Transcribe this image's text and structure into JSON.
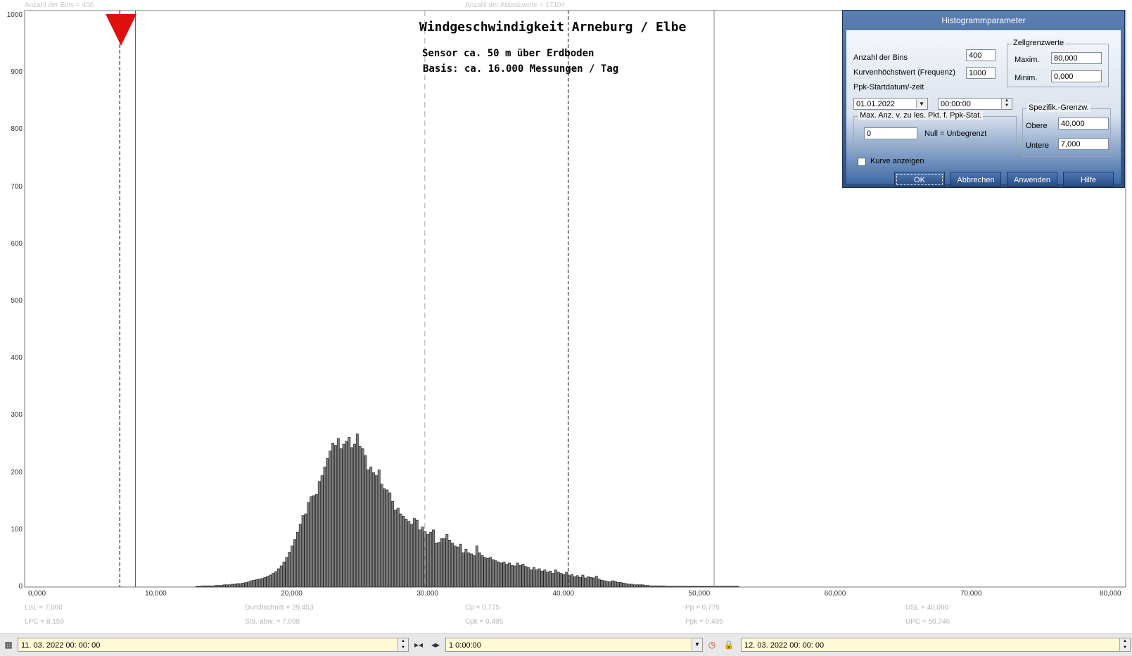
{
  "header": {
    "bins_info": "Anzahl der Bins =   400",
    "samples_info": "Anzahl der Abtastwerte = 17104"
  },
  "chart": {
    "title": "Windgeschwindigkeit  Arneburg / Elbe",
    "subtitle1": "Sensor ca. 50 m über Erdboden",
    "subtitle2": "Basis: ca. 16.000 Messungen / Tag"
  },
  "chart_data": {
    "type": "bar",
    "xlim": [
      0,
      80
    ],
    "ylim": [
      0,
      1000
    ],
    "bin_width": 0.2,
    "bin_start": 7.8,
    "y_ticks": [
      "0",
      "100",
      "200",
      "300",
      "400",
      "500",
      "600",
      "700",
      "800",
      "900",
      "1000"
    ],
    "x_ticks": [
      {
        "value": 0,
        "label": "0,000"
      },
      {
        "value": 10,
        "label": "10,000"
      },
      {
        "value": 20,
        "label": "20,000"
      },
      {
        "value": 30,
        "label": "30,000"
      },
      {
        "value": 40,
        "label": "40,000"
      },
      {
        "value": 50,
        "label": "50,000"
      },
      {
        "value": 60,
        "label": "60,000"
      },
      {
        "value": 70,
        "label": "70,000"
      },
      {
        "value": 80,
        "label": "80,000"
      }
    ],
    "reference_lines": {
      "lsl": 7.0,
      "lpc": 8.159,
      "mean": 29.453,
      "usl": 40.0,
      "upc": 50.746
    },
    "values": [
      0,
      0,
      0,
      0,
      0,
      0,
      0,
      0,
      0,
      0,
      0,
      0,
      0,
      0,
      0,
      0,
      0,
      0,
      0,
      0,
      0,
      0,
      0,
      0,
      1,
      1,
      2,
      2,
      2,
      2,
      2,
      3,
      3,
      3,
      4,
      4,
      4,
      5,
      5,
      6,
      6,
      7,
      8,
      9,
      11,
      12,
      13,
      14,
      15,
      17,
      19,
      21,
      24,
      27,
      32,
      37,
      44,
      52,
      61,
      72,
      83,
      96,
      110,
      125,
      128,
      148,
      158,
      160,
      162,
      185,
      195,
      210,
      225,
      238,
      252,
      248,
      260,
      242,
      250,
      255,
      262,
      244,
      250,
      268,
      246,
      242,
      230,
      205,
      210,
      200,
      195,
      205,
      180,
      172,
      170,
      165,
      150,
      135,
      138,
      128,
      124,
      119,
      115,
      110,
      120,
      117,
      100,
      105,
      97,
      92,
      96,
      100,
      77,
      78,
      85,
      85,
      92,
      82,
      77,
      72,
      70,
      75,
      60,
      66,
      60,
      58,
      55,
      72,
      60,
      55,
      52,
      50,
      52,
      48,
      46,
      44,
      42,
      44,
      40,
      42,
      38,
      37,
      42,
      38,
      40,
      36,
      34,
      30,
      34,
      30,
      32,
      28,
      30,
      26,
      28,
      24,
      30,
      26,
      24,
      22,
      26,
      20,
      22,
      18,
      20,
      17,
      21,
      16,
      18,
      17,
      16,
      19,
      14,
      12,
      11,
      10,
      9,
      11,
      10,
      8,
      8,
      7,
      6,
      5,
      5,
      4,
      4,
      4,
      4,
      3,
      3,
      2,
      2,
      2,
      2,
      2,
      2,
      1,
      1,
      1,
      1,
      1,
      1,
      1,
      1,
      1,
      1,
      1,
      1,
      1,
      1,
      1,
      1,
      1,
      1,
      1,
      1,
      1,
      1,
      1,
      1,
      1,
      1,
      1
    ]
  },
  "stats": {
    "lsl": "LSL = 7,000",
    "lpc": "LPC = 8,159",
    "mean": "Durchschnitt  = 29,453",
    "std": "Std.-abw. = 7,098",
    "cp": "Cp  = 0,775",
    "cpk": "Cpk = 0,495",
    "pp": "Pp  = 0,775",
    "ppk": "Ppk = 0,495",
    "usl": "USL = 40,000",
    "upc": "UPC = 50,746"
  },
  "dialog": {
    "title": "Histogrammparameter",
    "bins_label": "Anzahl der Bins",
    "bins_value": "400",
    "curve_max_label": "Kurvenhöchstwert (Frequenz)",
    "curve_max_value": "1000",
    "ppk_start_label": "Ppk-Startdatum/-zeit",
    "date_value": "01.01.2022",
    "time_value": "00:00:00",
    "cell_group_title": "Zellgrenzwerte",
    "maxim_label": "Maxim.",
    "maxim_value": "80,000",
    "minim_label": "Minim.",
    "minim_value": "0,000",
    "maxpts_group_title": "Max. Anz. v. zu les. Pkt. f. Ppk-Stat.",
    "maxpts_value": "0",
    "null_label": "Null = Unbegrenzt",
    "spec_group_title": "Spezifik.-Grenzw.",
    "upper_label": "Obere",
    "upper_value": "40,000",
    "lower_label": "Untere",
    "lower_value": "7,000",
    "show_curve_label": "Kurve anzeigen",
    "ok": "OK",
    "cancel": "Abbrechen",
    "apply": "Anwenden",
    "help": "Hilfe"
  },
  "toolbar": {
    "start": "11. 03. 2022   00: 00: 00",
    "interval": "1 0:00:00",
    "end": "12. 03. 2022   00: 00: 00"
  }
}
